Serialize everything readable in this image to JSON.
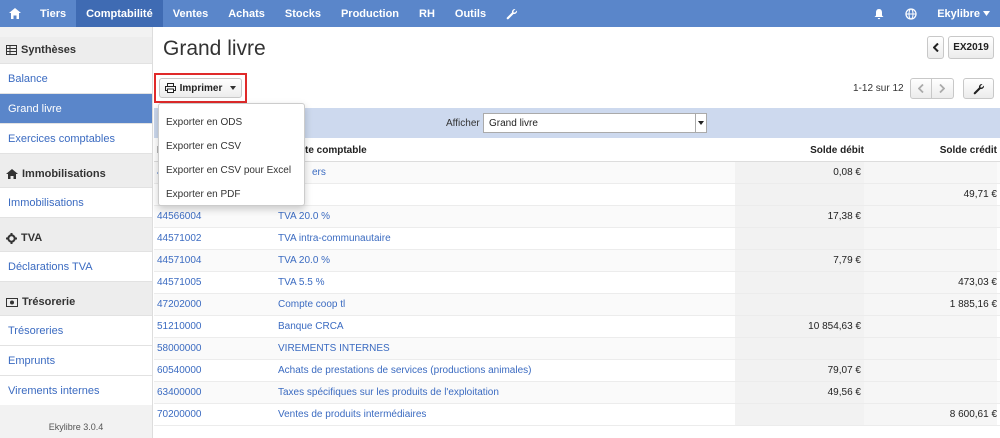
{
  "nav": {
    "items": [
      {
        "label": "Tiers",
        "active": false
      },
      {
        "label": "Comptabilité",
        "active": true
      },
      {
        "label": "Ventes",
        "active": false
      },
      {
        "label": "Achats",
        "active": false
      },
      {
        "label": "Stocks",
        "active": false
      },
      {
        "label": "Production",
        "active": false
      },
      {
        "label": "RH",
        "active": false
      },
      {
        "label": "Outils",
        "active": false
      }
    ],
    "user": "Ekylibre"
  },
  "sidebar": {
    "syntheses": {
      "title": "Synthèses",
      "items": [
        "Balance",
        "Grand livre",
        "Exercices comptables"
      ]
    },
    "immobilisations": {
      "title": "Immobilisations",
      "items": [
        "Immobilisations"
      ]
    },
    "tva": {
      "title": "TVA",
      "items": [
        "Déclarations TVA"
      ]
    },
    "tresorerie": {
      "title": "Trésorerie",
      "items": [
        "Trésoreries",
        "Emprunts",
        "Virements internes"
      ]
    },
    "version": "Ekylibre 3.0.4"
  },
  "page": {
    "title": "Grand livre",
    "exercise_button": "EX2019",
    "print_button": "Imprimer",
    "pager_text": "1-12 sur 12",
    "filter_label": "Afficher",
    "filter_value": "Grand livre"
  },
  "print_menu": [
    "Exporter en ODS",
    "Exporter en CSV",
    "Exporter en CSV pour Excel",
    "Exporter en PDF"
  ],
  "table": {
    "headers": {
      "number": "N",
      "account": "te comptable",
      "debit": "Solde débit",
      "credit": "Solde crédit"
    },
    "rows": [
      {
        "number": "4",
        "name": "ers",
        "debit": "0,08 €",
        "credit": ""
      },
      {
        "number": "",
        "name": "",
        "debit": "",
        "credit": "49,71 €"
      },
      {
        "number": "44566004",
        "name": "TVA 20.0 %",
        "debit": "17,38 €",
        "credit": ""
      },
      {
        "number": "44571002",
        "name": "TVA intra-communautaire",
        "debit": "",
        "credit": ""
      },
      {
        "number": "44571004",
        "name": "TVA 20.0 %",
        "debit": "7,79 €",
        "credit": ""
      },
      {
        "number": "44571005",
        "name": "TVA 5.5 %",
        "debit": "",
        "credit": "473,03 €"
      },
      {
        "number": "47202000",
        "name": "Compte coop tl",
        "debit": "",
        "credit": "1 885,16 €"
      },
      {
        "number": "51210000",
        "name": "Banque CRCA",
        "debit": "10 854,63 €",
        "credit": ""
      },
      {
        "number": "58000000",
        "name": "VIREMENTS INTERNES",
        "debit": "",
        "credit": ""
      },
      {
        "number": "60540000",
        "name": "Achats de prestations de services (productions animales)",
        "debit": "79,07 €",
        "credit": ""
      },
      {
        "number": "63400000",
        "name": "Taxes spécifiques sur les produits de l'exploitation",
        "debit": "49,56 €",
        "credit": ""
      },
      {
        "number": "70200000",
        "name": "Ventes de produits intermédiaires",
        "debit": "",
        "credit": "8 600,61 €"
      }
    ]
  },
  "colors": {
    "nav": "#5a86ca",
    "nav_active": "#3f6bb3",
    "link": "#3b6bc1",
    "filter_bar": "#cdd9ee",
    "highlight": "#e02a2a"
  }
}
